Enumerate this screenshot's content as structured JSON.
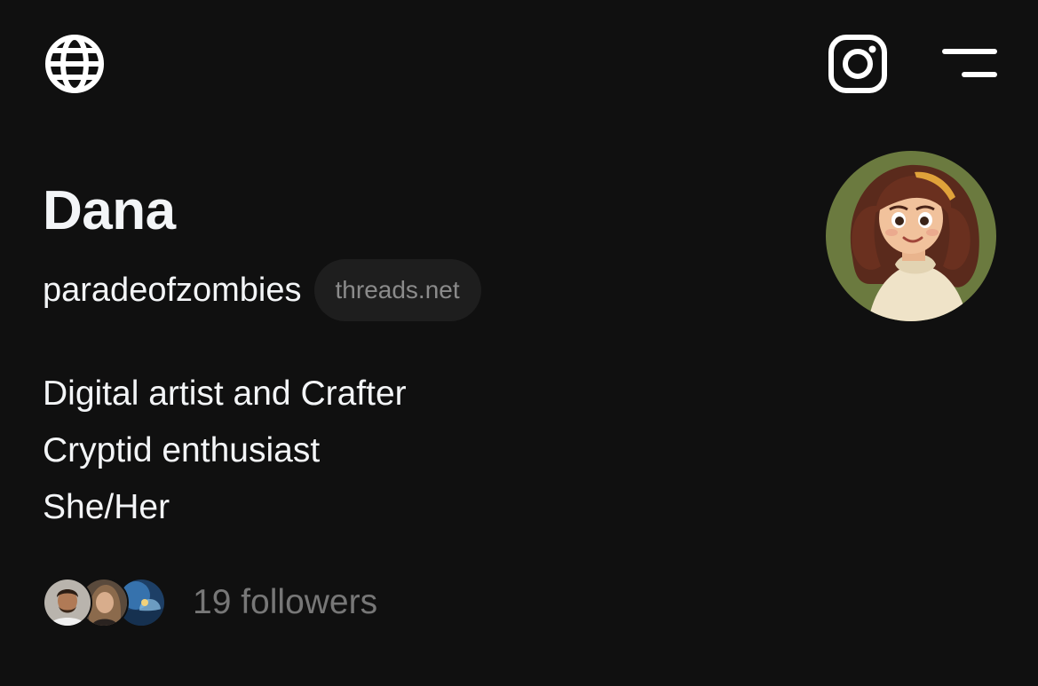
{
  "header": {
    "left_icon": "globe-icon",
    "right_icons": [
      "instagram-icon",
      "menu-icon"
    ]
  },
  "profile": {
    "name": "Dana",
    "handle": "paradeofzombies",
    "domain_badge": "threads.net",
    "bio_lines": [
      "Digital artist and Crafter",
      "Cryptid enthusiast",
      "She/Her"
    ],
    "followers_text": "19 followers"
  },
  "colors": {
    "background": "#101010",
    "primary_text": "#f3f5f7",
    "secondary_text": "#777777",
    "badge_background": "#1e1e1e",
    "badge_text": "#8b8b8b",
    "avatar_background": "#6b7a3f"
  }
}
